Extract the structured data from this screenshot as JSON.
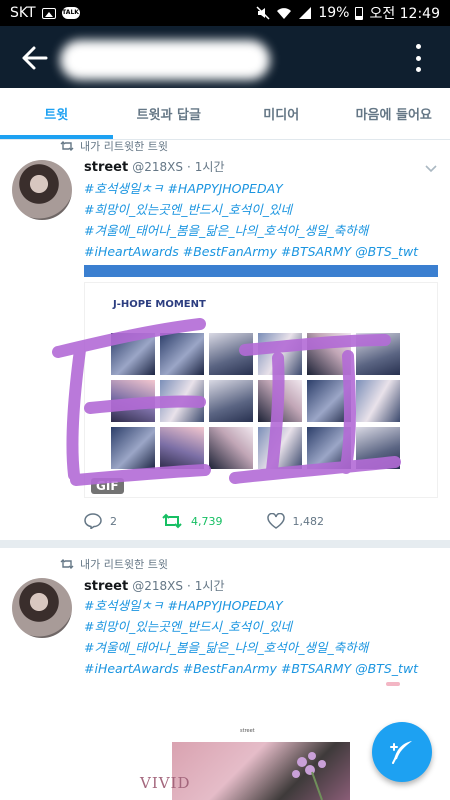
{
  "status_bar": {
    "carrier": "SKT",
    "talk_badge": "TALK",
    "battery_percent": "19%",
    "time": "오전 12:49"
  },
  "tabs": [
    {
      "label": "트윗",
      "active": true
    },
    {
      "label": "트윗과 답글",
      "active": false
    },
    {
      "label": "미디어",
      "active": false
    },
    {
      "label": "마음에 들어요",
      "active": false
    }
  ],
  "tweets": [
    {
      "retweet_label": "내가 리트윗한 트윗",
      "author": "street",
      "handle": "@218XS",
      "separator": "·",
      "time": "1시간",
      "lines": [
        "#호석생일ㅊㅋ #HAPPYJHOPEDAY",
        "#희망이_있는곳엔_반드시_호석이_있네",
        "#겨울에_태어나_봄을_닮은_나의_호석아_생일_축하해",
        "#iHeartAwards #BestFanArmy #BTSARMY @BTS_twt"
      ],
      "media_title": "J-HOPE MOMENT",
      "gif_badge": "GIF",
      "replies": "2",
      "retweets": "4,739",
      "likes": "1,482"
    },
    {
      "retweet_label": "내가 리트윗한 트윗",
      "author": "street",
      "handle": "@218XS",
      "separator": "·",
      "time": "1시간",
      "lines": [
        "#호석생일ㅊㅋ #HAPPYJHOPEDAY",
        "#희망이_있는곳엔_반드시_호석이_있네",
        "#겨울에_태어나_봄을_닮은_나의_호석아_생일_축하해",
        "#iHeartAwards #BestFanArmy #BTSARMY @BTS_twt"
      ],
      "media_label": "VIVID",
      "media_header": "street"
    }
  ],
  "colors": {
    "accent": "#1da1f2",
    "retweet_green": "#17bf63",
    "overlay_purple": "#b36bd6"
  }
}
